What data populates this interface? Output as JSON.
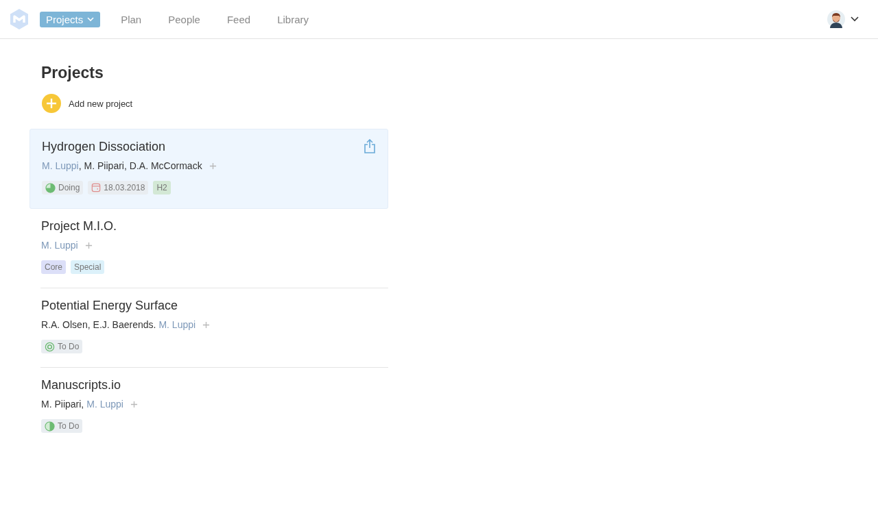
{
  "nav": {
    "items": [
      {
        "label": "Projects",
        "selected": true
      },
      {
        "label": "Plan",
        "selected": false
      },
      {
        "label": "People",
        "selected": false
      },
      {
        "label": "Feed",
        "selected": false
      },
      {
        "label": "Library",
        "selected": false
      }
    ]
  },
  "page": {
    "title": "Projects",
    "add_label": "Add new project"
  },
  "projects": [
    {
      "title": "Hydrogen Dissociation",
      "selected": true,
      "authors": [
        {
          "name": "M. Luppi",
          "me": true,
          "punct": ","
        },
        {
          "name": "M. Piipari",
          "me": false,
          "punct": ","
        },
        {
          "name": "D.A. McCormack",
          "me": false
        }
      ],
      "tags": [
        {
          "kind": "pie",
          "label": "Doing"
        },
        {
          "kind": "date",
          "label": "18.03.2018"
        },
        {
          "kind": "label",
          "label": "H2",
          "color": "#d3e8d5"
        }
      ]
    },
    {
      "title": "Project M.I.O.",
      "selected": false,
      "authors": [
        {
          "name": "M. Luppi",
          "me": true
        }
      ],
      "tags": [
        {
          "kind": "label",
          "label": "Core",
          "color": "#dcdff8"
        },
        {
          "kind": "label",
          "label": "Special",
          "color": "#dcf1fa"
        }
      ]
    },
    {
      "title": "Potential Energy Surface",
      "selected": false,
      "authors": [
        {
          "name": "R.A. Olsen",
          "me": false,
          "punct": ","
        },
        {
          "name": "E.J. Baerends",
          "me": false,
          "punct": "."
        },
        {
          "name": "M. Luppi",
          "me": true
        }
      ],
      "tags": [
        {
          "kind": "target",
          "label": "To Do"
        }
      ]
    },
    {
      "title": "Manuscripts.io",
      "selected": false,
      "authors": [
        {
          "name": "M. Piipari",
          "me": false,
          "punct": ","
        },
        {
          "name": "M. Luppi",
          "me": true
        }
      ],
      "tags": [
        {
          "kind": "pie",
          "label": "To Do"
        }
      ]
    }
  ]
}
